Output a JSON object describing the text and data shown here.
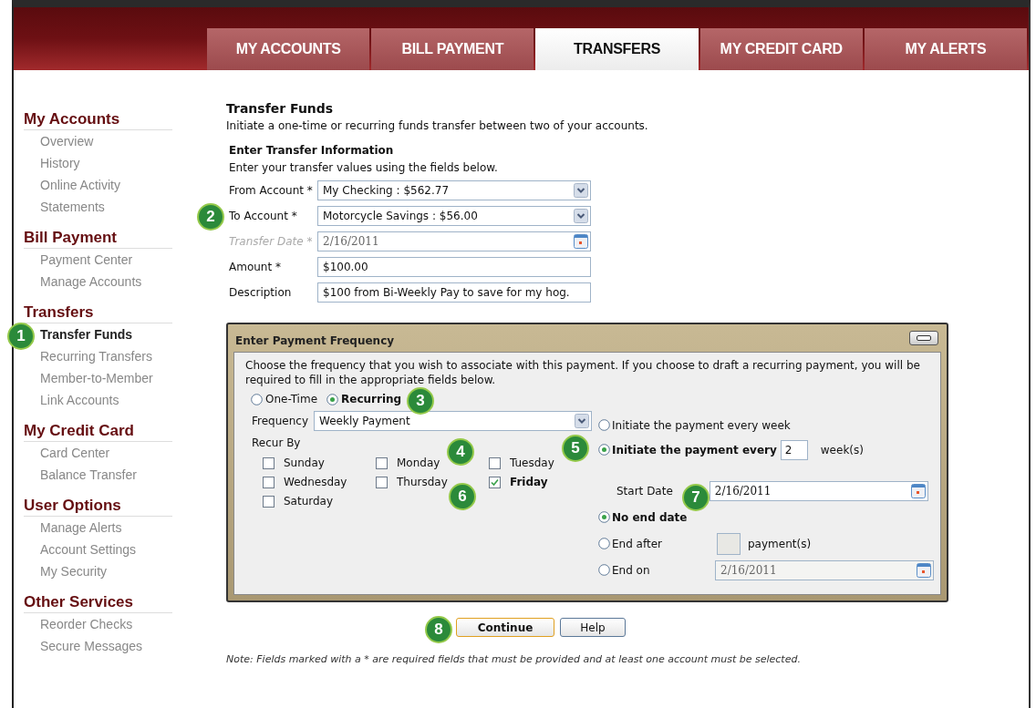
{
  "nav_tabs": [
    {
      "label": "MY ACCOUNTS",
      "selected": false
    },
    {
      "label": "BILL PAYMENT",
      "selected": false
    },
    {
      "label": "TRANSFERS",
      "selected": true
    },
    {
      "label": "MY CREDIT CARD",
      "selected": false
    },
    {
      "label": "MY ALERTS",
      "selected": false
    }
  ],
  "sidebar": {
    "sections": [
      {
        "title": "My Accounts",
        "items": [
          {
            "label": "Overview",
            "selected": false
          },
          {
            "label": "History",
            "selected": false
          },
          {
            "label": "Online Activity",
            "selected": false
          },
          {
            "label": "Statements",
            "selected": false
          }
        ]
      },
      {
        "title": "Bill Payment",
        "items": [
          {
            "label": "Payment Center",
            "selected": false
          },
          {
            "label": "Manage Accounts",
            "selected": false
          }
        ]
      },
      {
        "title": "Transfers",
        "items": [
          {
            "label": "Transfer Funds",
            "selected": true
          },
          {
            "label": "Recurring Transfers",
            "selected": false
          },
          {
            "label": "Member-to-Member",
            "selected": false
          },
          {
            "label": "Link Accounts",
            "selected": false
          }
        ]
      },
      {
        "title": "My Credit Card",
        "items": [
          {
            "label": "Card Center",
            "selected": false
          },
          {
            "label": "Balance Transfer",
            "selected": false
          }
        ]
      },
      {
        "title": "User Options",
        "items": [
          {
            "label": "Manage Alerts",
            "selected": false
          },
          {
            "label": "Account Settings",
            "selected": false
          },
          {
            "label": "My Security",
            "selected": false
          }
        ]
      },
      {
        "title": "Other Services",
        "items": [
          {
            "label": "Reorder Checks",
            "selected": false
          },
          {
            "label": "Secure Messages",
            "selected": false
          }
        ]
      }
    ]
  },
  "page": {
    "title": "Transfer Funds",
    "subtitle": "Initiate a one-time or recurring funds transfer between two of your accounts."
  },
  "transfer_info": {
    "heading": "Enter Transfer Information",
    "hint": "Enter your transfer values using the fields below.",
    "fields": [
      {
        "label": "From Account *",
        "kind": "select",
        "value": "My Checking : $562.77",
        "disabled": false
      },
      {
        "label": "To Account *",
        "kind": "select",
        "value": "Motorcycle Savings : $56.00",
        "disabled": false
      },
      {
        "label": "Transfer Date *",
        "kind": "date",
        "value": "2/16/2011",
        "disabled": true
      },
      {
        "label": "Amount *",
        "kind": "text",
        "value": "$100.00",
        "disabled": false
      },
      {
        "label": "Description",
        "kind": "text",
        "value": "$100 from Bi-Weekly Pay to save for my hog.",
        "disabled": false
      }
    ]
  },
  "frequency_panel": {
    "title": "Enter Payment Frequency",
    "intro": "Choose the frequency that you wish to associate with this payment. If you choose to draft a recurring payment, you will be required to fill in the appropriate fields below.",
    "schedule_type": [
      {
        "label": "One-Time",
        "selected": false
      },
      {
        "label": "Recurring",
        "selected": true
      }
    ],
    "frequency": {
      "label": "Frequency",
      "value": "Weekly Payment"
    },
    "recur_by": {
      "label": "Recur By",
      "days": [
        {
          "label": "Sunday",
          "checked": false
        },
        {
          "label": "Monday",
          "checked": false
        },
        {
          "label": "Tuesday",
          "checked": false
        },
        {
          "label": "Wednesday",
          "checked": false
        },
        {
          "label": "Thursday",
          "checked": false
        },
        {
          "label": "Friday",
          "checked": true
        },
        {
          "label": "Saturday",
          "checked": false
        }
      ]
    },
    "interval_options": [
      {
        "kind": "plain",
        "label": "Initiate the payment every week",
        "selected": false
      },
      {
        "kind": "count",
        "label": "Initiate the payment every",
        "value": "2",
        "unit": "week(s)",
        "selected": true
      }
    ],
    "start_date": {
      "label": "Start Date",
      "value": "2/16/2011"
    },
    "end_options": [
      {
        "kind": "plain",
        "label": "No end date",
        "selected": true
      },
      {
        "kind": "count",
        "label": "End after",
        "unit": "payment(s)",
        "selected": false
      },
      {
        "kind": "date",
        "label": "End on",
        "value": "2/16/2011",
        "selected": false
      }
    ]
  },
  "buttons": [
    {
      "label": "Continue",
      "primary": true
    },
    {
      "label": "Help",
      "primary": false
    }
  ],
  "note": "Note: Fields marked with a * are required fields that must be provided and at least one account must be selected.",
  "callouts": [
    "1",
    "2",
    "3",
    "4",
    "5",
    "6",
    "7",
    "8"
  ]
}
